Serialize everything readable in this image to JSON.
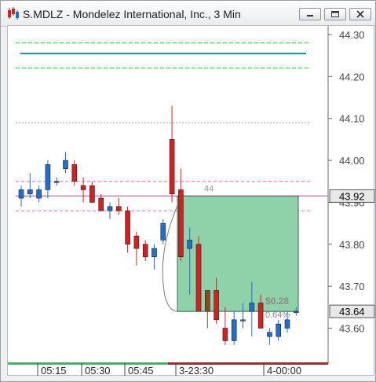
{
  "window": {
    "title": "S.MDLZ - Mondelez International, Inc., 3 Min",
    "icon": "candlestick-chart-icon",
    "buttons": [
      "minimize",
      "restore",
      "close"
    ]
  },
  "chart_data": {
    "type": "candlestick",
    "title": "S.MDLZ - Mondelez International, Inc., 3 Min",
    "ylim": [
      43.545,
      44.32
    ],
    "y_ticks": [
      "44.30",
      "44.20",
      "44.10",
      "44.00",
      "43.90",
      "43.80",
      "43.70",
      "43.60"
    ],
    "x_ticks": [
      "05:15",
      "05:30",
      "05:45",
      "3-23:30",
      "4-00:00"
    ],
    "current_price_tag": "43.92",
    "last_price_tag": "43.64",
    "box_label_top": "44",
    "box_label_profit": "$0.28",
    "box_label_percent": "0.64%",
    "levels": {
      "green_dashed": [
        44.28,
        44.22
      ],
      "teal_solid": 44.255,
      "gray_dotted": 44.09,
      "pink_dashed": [
        43.95,
        43.88
      ],
      "pink_solid": 43.915
    },
    "colors": {
      "up": "#1f6fd0",
      "down": "#d62020",
      "brown_candle": "#8a4a20",
      "teal": "#14a0a0",
      "green_level": "#2ec24a",
      "pink_level": "#e96fa6",
      "box_fill": "#8fd1a8",
      "box_border": "#2f6b44"
    },
    "candles": [
      {
        "o": 43.91,
        "h": 43.94,
        "l": 43.89,
        "c": 43.93
      },
      {
        "o": 43.92,
        "h": 43.97,
        "l": 43.91,
        "c": 43.93
      },
      {
        "o": 43.91,
        "h": 43.94,
        "l": 43.9,
        "c": 43.93
      },
      {
        "o": 43.93,
        "h": 44.0,
        "l": 43.91,
        "c": 43.99
      },
      {
        "o": 43.95,
        "h": 43.96,
        "l": 43.94,
        "c": 43.95
      },
      {
        "o": 43.98,
        "h": 44.02,
        "l": 43.97,
        "c": 44.0
      },
      {
        "o": 43.99,
        "h": 44.0,
        "l": 43.94,
        "c": 43.95
      },
      {
        "o": 43.94,
        "h": 43.96,
        "l": 43.9,
        "c": 43.93
      },
      {
        "o": 43.94,
        "h": 43.95,
        "l": 43.9,
        "c": 43.9
      },
      {
        "o": 43.91,
        "h": 43.92,
        "l": 43.88,
        "c": 43.88
      },
      {
        "o": 43.88,
        "h": 43.9,
        "l": 43.86,
        "c": 43.89
      },
      {
        "o": 43.89,
        "h": 43.91,
        "l": 43.87,
        "c": 43.88
      },
      {
        "o": 43.88,
        "h": 43.89,
        "l": 43.78,
        "c": 43.8
      },
      {
        "o": 43.82,
        "h": 43.83,
        "l": 43.75,
        "c": 43.79
      },
      {
        "o": 43.8,
        "h": 43.81,
        "l": 43.76,
        "c": 43.77
      },
      {
        "o": 43.77,
        "h": 43.8,
        "l": 43.74,
        "c": 43.79
      },
      {
        "o": 43.81,
        "h": 43.86,
        "l": 43.8,
        "c": 43.85
      },
      {
        "o": 44.05,
        "h": 44.13,
        "l": 43.9,
        "c": 43.92
      },
      {
        "o": 43.93,
        "h": 43.98,
        "l": 43.76,
        "c": 43.77
      },
      {
        "o": 43.79,
        "h": 43.84,
        "l": 43.68,
        "c": 43.81
      },
      {
        "o": 43.8,
        "h": 43.82,
        "l": 43.64,
        "c": 43.64
      },
      {
        "o": 43.64,
        "h": 43.69,
        "l": 43.6,
        "c": 43.69
      },
      {
        "o": 43.69,
        "h": 43.72,
        "l": 43.61,
        "c": 43.62
      },
      {
        "o": 43.6,
        "h": 43.65,
        "l": 43.56,
        "c": 43.57
      },
      {
        "o": 43.57,
        "h": 43.64,
        "l": 43.56,
        "c": 43.62
      },
      {
        "o": 43.62,
        "h": 43.66,
        "l": 43.6,
        "c": 43.62
      },
      {
        "o": 43.64,
        "h": 43.71,
        "l": 43.58,
        "c": 43.66
      },
      {
        "o": 43.66,
        "h": 43.68,
        "l": 43.6,
        "c": 43.6
      },
      {
        "o": 43.58,
        "h": 43.6,
        "l": 43.56,
        "c": 43.59
      },
      {
        "o": 43.58,
        "h": 43.62,
        "l": 43.57,
        "c": 43.61
      },
      {
        "o": 43.6,
        "h": 43.64,
        "l": 43.59,
        "c": 43.62
      },
      {
        "o": 43.64,
        "h": 43.65,
        "l": 43.63,
        "c": 43.64
      }
    ]
  }
}
